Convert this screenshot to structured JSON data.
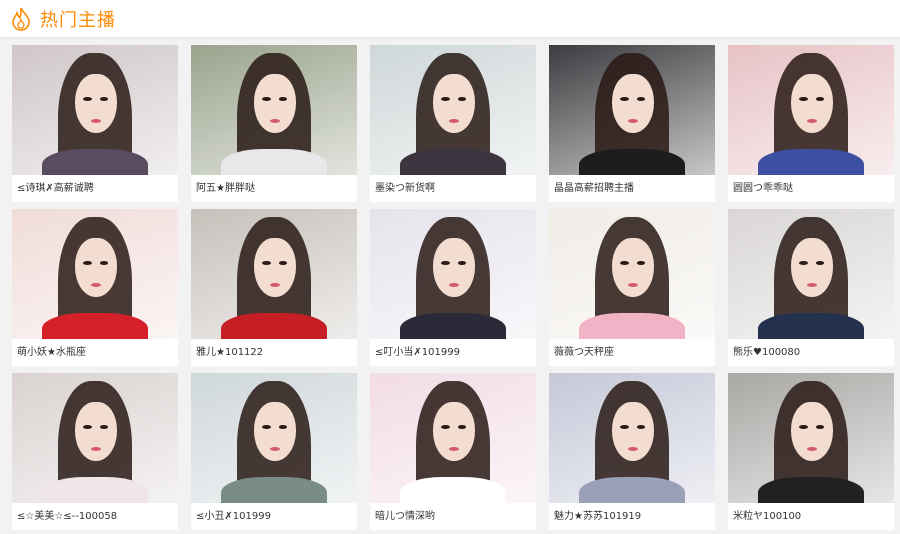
{
  "header": {
    "title": "热门主播",
    "icon": "flame-icon",
    "accent": "#ff8a00"
  },
  "cards": [
    {
      "name": "≤诗琪✗高薪诚聘",
      "bg": "#cfc6c8",
      "shirt": "#5a4c60"
    },
    {
      "name": "阿五★胖胖哒",
      "bg": "#9aa38c",
      "shirt": "#e9e7ea"
    },
    {
      "name": "墨染つ新货啊",
      "bg": "#cfd7d8",
      "shirt": "#3c3540"
    },
    {
      "name": "晶晶高薪招聘主播",
      "bg": "#3c3c40",
      "shirt": "#1f1c1d"
    },
    {
      "name": "圆圆つ乖乖哒",
      "bg": "#e7c2c6",
      "shirt": "#3c4fa0"
    },
    {
      "name": "萌小妖★水瓶座",
      "bg": "#f0dcd9",
      "shirt": "#d5202a"
    },
    {
      "name": "雅儿★101122",
      "bg": "#c6c0ba",
      "shirt": "#c51e24"
    },
    {
      "name": "≤叮小当✗101999",
      "bg": "#e6e3ec",
      "shirt": "#2b2a38"
    },
    {
      "name": "薇薇つ天秤座",
      "bg": "#f0ece6",
      "shirt": "#f3b3c6"
    },
    {
      "name": "熊乐♥100080",
      "bg": "#d9d6d5",
      "shirt": "#23314e"
    },
    {
      "name": "≤☆美美☆≤--100058",
      "bg": "#d9d2d0",
      "shirt": "#f0e6e8"
    },
    {
      "name": "≤小丑✗101999",
      "bg": "#cfd7da",
      "shirt": "#7a8c86"
    },
    {
      "name": "暗儿つ情深哟",
      "bg": "#f2dce6",
      "shirt": "#ffffff"
    },
    {
      "name": "魅力★苏苏101919",
      "bg": "#c5c8d8",
      "shirt": "#9aa0b8"
    },
    {
      "name": "米粒ヤ100100",
      "bg": "#a9a7a4",
      "shirt": "#222020"
    }
  ]
}
